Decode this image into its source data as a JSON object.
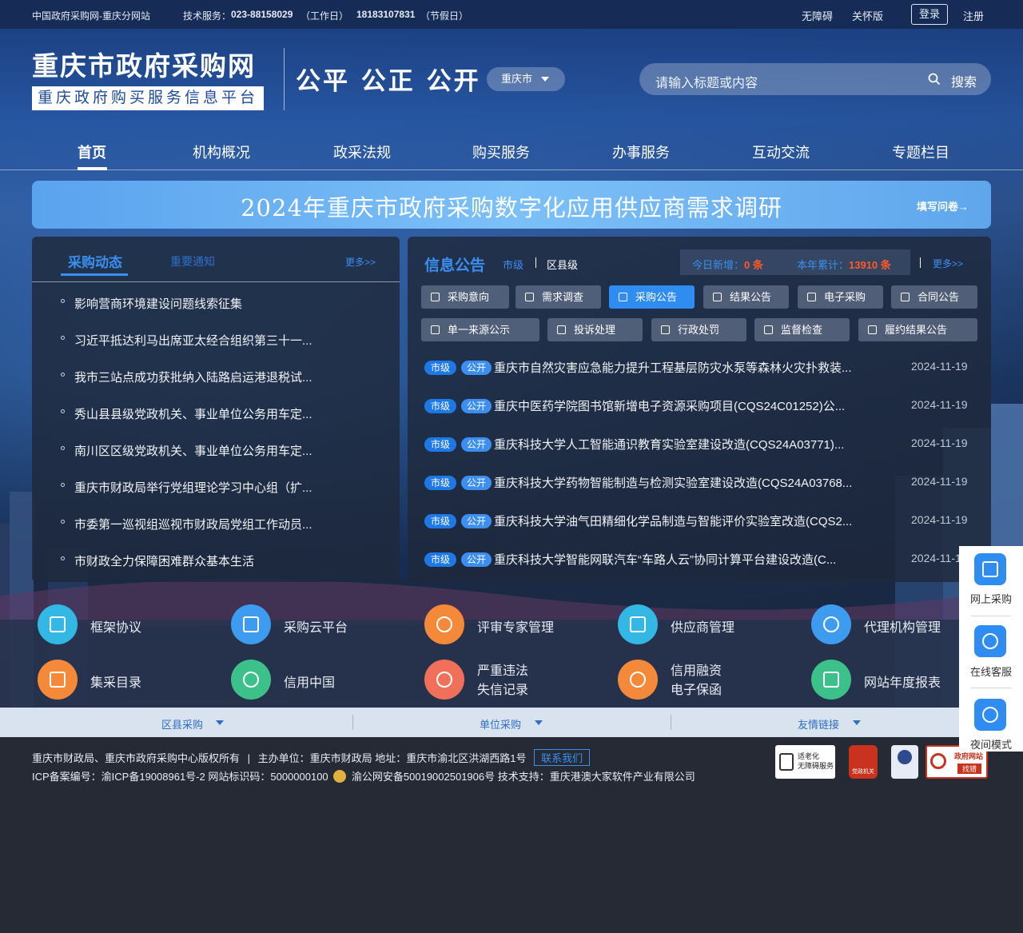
{
  "topbar": {
    "site_name": "中国政府采购网-重庆分网站",
    "support_label": "技术服务：",
    "support_phone1": "023-88158029",
    "support_note1": "（工作日）",
    "support_phone2": "18183107831",
    "support_note2": "（节假日）",
    "accessibility": "无障碍",
    "elder_mode": "关怀版",
    "login": "登录",
    "register": "注册"
  },
  "header": {
    "logo_title": "重庆市政府采购网",
    "logo_subtitle": "重庆政府购买服务信息平台",
    "slogan": "公平 公正 公开",
    "city_select": "重庆市",
    "search_placeholder": "请输入标题或内容",
    "search_button": "搜索"
  },
  "nav": {
    "items": [
      "首页",
      "机构概况",
      "政采法规",
      "购买服务",
      "办事服务",
      "互动交流",
      "专题栏目"
    ]
  },
  "banner": {
    "title": "2024年重庆市政府采购数字化应用供应商需求调研",
    "link": "填写问卷→"
  },
  "left_panel": {
    "tab_active": "采购动态",
    "tab_other": "重要通知",
    "more": "更多>>",
    "items": [
      "影响营商环境建设问题线索征集",
      "习近平抵达利马出席亚太经合组织第三十一...",
      "我市三站点成功获批纳入陆路启运港退税试...",
      "秀山县县级党政机关、事业单位公务用车定...",
      "南川区区级党政机关、事业单位公务用车定...",
      "重庆市财政局举行党组理论学习中心组（扩...",
      "市委第一巡视组巡视市财政局党组工作动员...",
      "市财政全力保障困难群众基本生活"
    ]
  },
  "right_panel": {
    "title": "信息公告",
    "level_city": "市级",
    "level_district": "区县级",
    "today_label": "今日新增：",
    "today_value": "0 条",
    "year_label": "本年累计：",
    "year_value": "13910 条",
    "more": "更多>>",
    "categories_row1": [
      "采购意向",
      "需求调查",
      "采购公告",
      "结果公告",
      "电子采购",
      "合同公告"
    ],
    "categories_row2": [
      "单一来源公示",
      "投诉处理",
      "行政处罚",
      "监督检查",
      "履约结果公告"
    ],
    "active_category": "采购公告",
    "badge_level": "市级",
    "badge_type": "公开",
    "rows": [
      {
        "title": "重庆市自然灾害应急能力提升工程基层防灾水泵等森林火灾扑救装...",
        "date": "2024-11-19"
      },
      {
        "title": "重庆中医药学院图书馆新增电子资源采购项目(CQS24C01252)公...",
        "date": "2024-11-19"
      },
      {
        "title": "重庆科技大学人工智能通识教育实验室建设改造(CQS24A03771)...",
        "date": "2024-11-19"
      },
      {
        "title": "重庆科技大学药物智能制造与检测实验室建设改造(CQS24A03768...",
        "date": "2024-11-19"
      },
      {
        "title": "重庆科技大学油气田精细化学品制造与智能评价实验室改造(CQS2...",
        "date": "2024-11-19"
      },
      {
        "title": "重庆科技大学智能网联汽车“车路人云”协同计算平台建设改造(C...",
        "date": "2024-11-19"
      }
    ]
  },
  "quick_links": {
    "row1": [
      {
        "label": "框架协议",
        "icon": "framework-icon",
        "color": "#33b8e6"
      },
      {
        "label": "采购云平台",
        "icon": "cloud-platform-icon",
        "color": "#3d9cf0"
      },
      {
        "label": "评审专家管理",
        "icon": "expert-icon",
        "color": "#f5893a"
      },
      {
        "label": "供应商管理",
        "icon": "supplier-icon",
        "color": "#33b8e6"
      },
      {
        "label": "代理机构管理",
        "icon": "agency-icon",
        "color": "#3d9cf0"
      }
    ],
    "row2": [
      {
        "label": "集采目录",
        "icon": "catalog-icon",
        "color": "#f5893a"
      },
      {
        "label": "信用中国",
        "icon": "credit-china-icon",
        "color": "#3cc18a"
      },
      {
        "label": "严重违法\n失信记录",
        "line1": "严重违法",
        "line2": "失信记录",
        "icon": "violation-icon",
        "color": "#f0705a"
      },
      {
        "label": "信用融资\n电子保函",
        "line1": "信用融资",
        "line2": "电子保函",
        "icon": "finance-icon",
        "color": "#f5893a"
      },
      {
        "label": "网站年度报表",
        "icon": "report-icon",
        "color": "#3cc18a"
      }
    ]
  },
  "bottom_tabs": [
    "区县采购",
    "单位采购",
    "友情链接"
  ],
  "footer": {
    "line1_copyright": "重庆市财政局、重庆市政府采购中心版权所有",
    "line1_host": "主办单位：重庆市财政局 地址：重庆市渝北区洪湖西路1号",
    "contact": "联系我们",
    "line2_icp": "ICP备案编号：渝ICP备19008961号-2 网站标识码：5000000100",
    "line2_police": "渝公网安备50019002501906号 技术支持：重庆港澳大家软件产业有限公司",
    "badge_accessible_1": "适老化",
    "badge_accessible_2": "无障碍服务",
    "badge_party": "党政机关",
    "badge_error_1": "政府网站",
    "badge_error_2": "找错"
  },
  "side_float": {
    "items": [
      "网上采购",
      "在线客服",
      "夜间模式"
    ]
  },
  "colors": {
    "accent": "#2f8cf0",
    "highlight": "#ff5a2a",
    "panel": "#1e283a"
  }
}
